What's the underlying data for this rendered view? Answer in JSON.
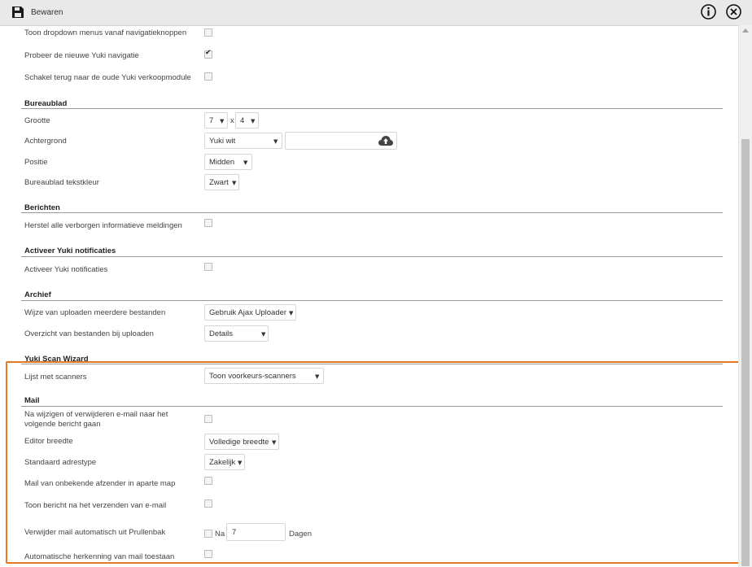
{
  "toolbar": {
    "save_label": "Bewaren",
    "info_icon": "info-circle-icon",
    "close_icon": "close-circle-icon"
  },
  "general": {
    "dropdown_nav": {
      "label": "Toon dropdown menus vanaf navigatieknoppen",
      "checked": false
    },
    "new_nav": {
      "label": "Probeer de nieuwe Yuki navigatie",
      "checked": true
    },
    "old_sales": {
      "label": "Schakel terug naar de oude Yuki verkoopmodule",
      "checked": false
    }
  },
  "desktop": {
    "title": "Bureaublad",
    "size_label": "Grootte",
    "size_x": "7",
    "size_sep": "x",
    "size_y": "4",
    "background_label": "Achtergrond",
    "background_value": "Yuki wit",
    "position_label": "Positie",
    "position_value": "Midden",
    "text_color_label": "Bureaublad tekstkleur",
    "text_color_value": "Zwart"
  },
  "messages": {
    "title": "Berichten",
    "restore_label": "Herstel alle verborgen informatieve meldingen",
    "checked": false
  },
  "notifications": {
    "title": "Activeer Yuki notificaties",
    "activate_label": "Activeer Yuki notificaties",
    "checked": false
  },
  "archive": {
    "title": "Archief",
    "upload_label": "Wijze van uploaden meerdere bestanden",
    "upload_value": "Gebruik Ajax Uploader",
    "overview_label": "Overzicht van bestanden bij uploaden",
    "overview_value": "Details"
  },
  "scan": {
    "title": "Yuki Scan Wizard",
    "scanners_label": "Lijst met scanners",
    "scanners_value": "Toon voorkeurs-scanners"
  },
  "mail": {
    "title": "Mail",
    "next_after_change_label": "Na wijzigen of verwijderen e-mail naar het volgende bericht gaan",
    "next_after_change_checked": false,
    "editor_width_label": "Editor breedte",
    "editor_width_value": "Volledige breedte",
    "address_type_label": "Standaard adrestype",
    "address_type_value": "Zakelijk",
    "unknown_sender_label": "Mail van onbekende afzender in aparte map",
    "unknown_sender_checked": false,
    "show_after_send_label": "Toon bericht na het verzenden van e-mail",
    "show_after_send_checked": false,
    "auto_delete_label": "Verwijder mail automatisch uit Prullenbak",
    "auto_delete_checked": false,
    "auto_delete_prefix": "Na",
    "auto_delete_days": "7",
    "auto_delete_suffix": "Dagen",
    "auto_recognition_label": "Automatische herkenning van mail toestaan",
    "auto_recognition_checked": false
  },
  "colors": {
    "highlight": "#e87722",
    "toolbar_bg": "#e9e9e9"
  }
}
